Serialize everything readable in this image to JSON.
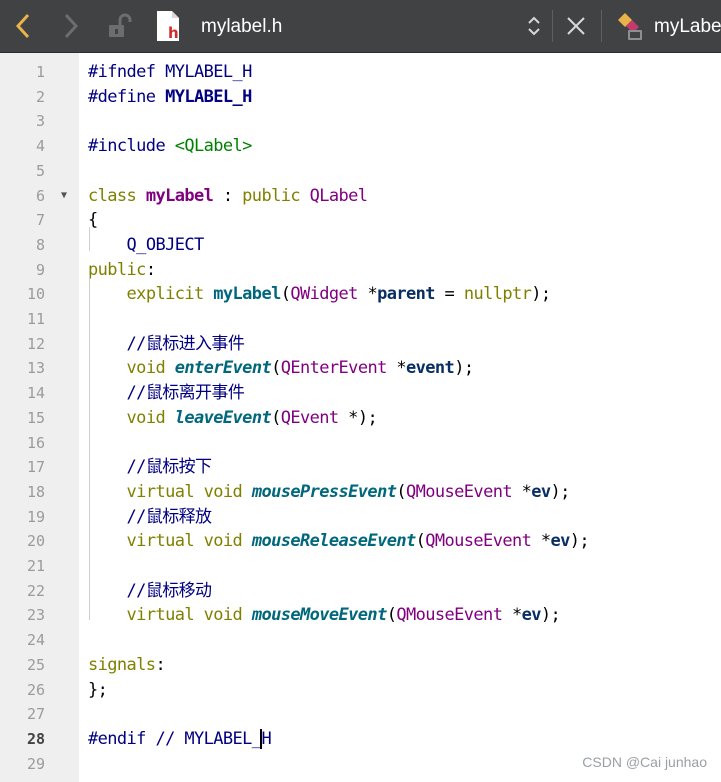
{
  "toolbar": {
    "file_name": "mylabel.h",
    "type_name": "myLabe",
    "file_icon_letter": "h",
    "colors": {
      "accent": "#e8b44a",
      "file_icon_red": "#d22b2b"
    }
  },
  "editor": {
    "current_line": 28,
    "lines": [
      {
        "n": "1",
        "tokens": [
          {
            "t": "#ifndef ",
            "c": "pre"
          },
          {
            "t": "MYLABEL_H",
            "c": "mac"
          }
        ]
      },
      {
        "n": "2",
        "tokens": [
          {
            "t": "#define ",
            "c": "pre"
          },
          {
            "t": "MYLABEL_H",
            "c": "macb"
          }
        ]
      },
      {
        "n": "3",
        "tokens": []
      },
      {
        "n": "4",
        "tokens": [
          {
            "t": "#include ",
            "c": "pre"
          },
          {
            "t": "<QLabel>",
            "c": "inc"
          }
        ]
      },
      {
        "n": "5",
        "tokens": []
      },
      {
        "n": "6",
        "fold": "▼",
        "tokens": [
          {
            "t": "class ",
            "c": "kw"
          },
          {
            "t": "myLabel",
            "c": "cls"
          },
          {
            "t": " : ",
            "c": "pl"
          },
          {
            "t": "public ",
            "c": "kw"
          },
          {
            "t": "QLabel",
            "c": "typ"
          }
        ]
      },
      {
        "n": "7",
        "tokens": [
          {
            "t": "{",
            "c": "pl"
          }
        ]
      },
      {
        "n": "8",
        "tokens": [
          {
            "t": "    ",
            "c": "pl"
          },
          {
            "t": "Q_OBJECT",
            "c": "mac"
          }
        ]
      },
      {
        "n": "9",
        "tokens": [
          {
            "t": "public",
            "c": "kw"
          },
          {
            "t": ":",
            "c": "pl"
          }
        ]
      },
      {
        "n": "10",
        "tokens": [
          {
            "t": "    ",
            "c": "pl"
          },
          {
            "t": "explicit ",
            "c": "kw"
          },
          {
            "t": "myLabel",
            "c": "fnb"
          },
          {
            "t": "(",
            "c": "pl"
          },
          {
            "t": "QWidget",
            "c": "typ"
          },
          {
            "t": " *",
            "c": "pl"
          },
          {
            "t": "parent",
            "c": "par"
          },
          {
            "t": " = ",
            "c": "pl"
          },
          {
            "t": "nullptr",
            "c": "kw"
          },
          {
            "t": ");",
            "c": "pl"
          }
        ]
      },
      {
        "n": "11",
        "tokens": []
      },
      {
        "n": "12",
        "tokens": [
          {
            "t": "    ",
            "c": "pl"
          },
          {
            "t": "//鼠标进入事件",
            "c": "cmt"
          }
        ]
      },
      {
        "n": "13",
        "tokens": [
          {
            "t": "    ",
            "c": "pl"
          },
          {
            "t": "void ",
            "c": "kw"
          },
          {
            "t": "enterEvent",
            "c": "vfn"
          },
          {
            "t": "(",
            "c": "pl"
          },
          {
            "t": "QEnterEvent",
            "c": "typ"
          },
          {
            "t": " *",
            "c": "pl"
          },
          {
            "t": "event",
            "c": "par"
          },
          {
            "t": ");",
            "c": "pl"
          }
        ]
      },
      {
        "n": "14",
        "tokens": [
          {
            "t": "    ",
            "c": "pl"
          },
          {
            "t": "//鼠标离开事件",
            "c": "cmt"
          }
        ]
      },
      {
        "n": "15",
        "tokens": [
          {
            "t": "    ",
            "c": "pl"
          },
          {
            "t": "void ",
            "c": "kw"
          },
          {
            "t": "leaveEvent",
            "c": "vfn"
          },
          {
            "t": "(",
            "c": "pl"
          },
          {
            "t": "QEvent",
            "c": "typ"
          },
          {
            "t": " *);",
            "c": "pl"
          }
        ]
      },
      {
        "n": "16",
        "tokens": []
      },
      {
        "n": "17",
        "tokens": [
          {
            "t": "    ",
            "c": "pl"
          },
          {
            "t": "//鼠标按下",
            "c": "cmt"
          }
        ]
      },
      {
        "n": "18",
        "tokens": [
          {
            "t": "    ",
            "c": "pl"
          },
          {
            "t": "virtual void ",
            "c": "kw"
          },
          {
            "t": "mousePressEvent",
            "c": "vfn2"
          },
          {
            "t": "(",
            "c": "pl"
          },
          {
            "t": "QMouseEvent",
            "c": "typ"
          },
          {
            "t": " *",
            "c": "pl"
          },
          {
            "t": "ev",
            "c": "par"
          },
          {
            "t": ");",
            "c": "pl"
          }
        ]
      },
      {
        "n": "19",
        "tokens": [
          {
            "t": "    ",
            "c": "pl"
          },
          {
            "t": "//鼠标释放",
            "c": "cmt"
          }
        ]
      },
      {
        "n": "20",
        "tokens": [
          {
            "t": "    ",
            "c": "pl"
          },
          {
            "t": "virtual void ",
            "c": "kw"
          },
          {
            "t": "mouseReleaseEvent",
            "c": "vfn2"
          },
          {
            "t": "(",
            "c": "pl"
          },
          {
            "t": "QMouseEvent",
            "c": "typ"
          },
          {
            "t": " *",
            "c": "pl"
          },
          {
            "t": "ev",
            "c": "par"
          },
          {
            "t": ");",
            "c": "pl"
          }
        ]
      },
      {
        "n": "21",
        "tokens": []
      },
      {
        "n": "22",
        "tokens": [
          {
            "t": "    ",
            "c": "pl"
          },
          {
            "t": "//鼠标移动",
            "c": "cmt"
          }
        ]
      },
      {
        "n": "23",
        "tokens": [
          {
            "t": "    ",
            "c": "pl"
          },
          {
            "t": "virtual void ",
            "c": "kw"
          },
          {
            "t": "mouseMoveEvent",
            "c": "vfn2"
          },
          {
            "t": "(",
            "c": "pl"
          },
          {
            "t": "QMouseEvent",
            "c": "typ"
          },
          {
            "t": " *",
            "c": "pl"
          },
          {
            "t": "ev",
            "c": "par"
          },
          {
            "t": ");",
            "c": "pl"
          }
        ]
      },
      {
        "n": "24",
        "tokens": []
      },
      {
        "n": "25",
        "tokens": [
          {
            "t": "signals",
            "c": "kw"
          },
          {
            "t": ":",
            "c": "pl"
          }
        ]
      },
      {
        "n": "26",
        "tokens": [
          {
            "t": "};",
            "c": "pl"
          }
        ]
      },
      {
        "n": "27",
        "tokens": []
      },
      {
        "n": "28",
        "tokens": [
          {
            "t": "#endif ",
            "c": "pre"
          },
          {
            "t": "// ",
            "c": "cmt"
          },
          {
            "t": "MYLABEL_",
            "c": "mac"
          },
          {
            "t": "H",
            "c": "mac",
            "cursor_before": true
          }
        ]
      },
      {
        "n": "29",
        "tokens": []
      }
    ],
    "token_colors": {
      "pre": "#000080",
      "mac": "#000080",
      "macb": "#000080",
      "inc": "#008000",
      "kw": "#808000",
      "cls": "#800080",
      "typ": "#800080",
      "pl": "#000000",
      "fnb": "#00677c",
      "par": "#092e64",
      "vfn": "#00677c",
      "vfn2": "#00677c",
      "cmt": "#000080"
    }
  },
  "watermark": "CSDN @Cai junhao"
}
